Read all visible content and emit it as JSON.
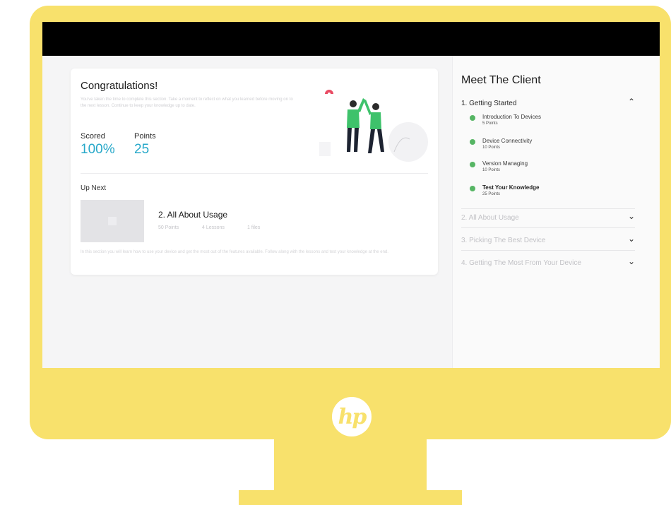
{
  "brand": {
    "logo_text": "hp",
    "frame_color": "#f8e16c"
  },
  "completion": {
    "title": "Congratulations!",
    "description": "You've taken the time to complete this section. Take a moment to reflect on what you learned before moving on to the next lesson. Continue to keep your knowledge up to date.",
    "scored_label": "Scored",
    "scored_value": "100%",
    "points_label": "Points",
    "points_value": "25",
    "accent_color": "#27a8c9"
  },
  "up_next": {
    "label": "Up Next",
    "title": "2. All About Usage",
    "points": "50 Points",
    "lessons": "4 Lessons",
    "files": "1 files",
    "description": "In this section you will learn how to use your device and get the most out of the features available. Follow along with the lessons and test your knowledge at the end."
  },
  "sidebar": {
    "title": "Meet The Client",
    "sections": [
      {
        "label": "1. Getting Started",
        "expanded": true,
        "lessons": [
          {
            "title": "Introduction To Devices",
            "points": "5 Points"
          },
          {
            "title": "Device Connectivity",
            "points": "10 Points"
          },
          {
            "title": "Version Managing",
            "points": "10 Points"
          },
          {
            "title": "Test Your Knowledge",
            "points": "25 Points",
            "current": true
          }
        ]
      },
      {
        "label": "2. All About Usage",
        "expanded": false
      },
      {
        "label": "3. Picking The Best Device",
        "expanded": false
      },
      {
        "label": "4. Getting The Most From Your Device",
        "expanded": false
      }
    ]
  }
}
